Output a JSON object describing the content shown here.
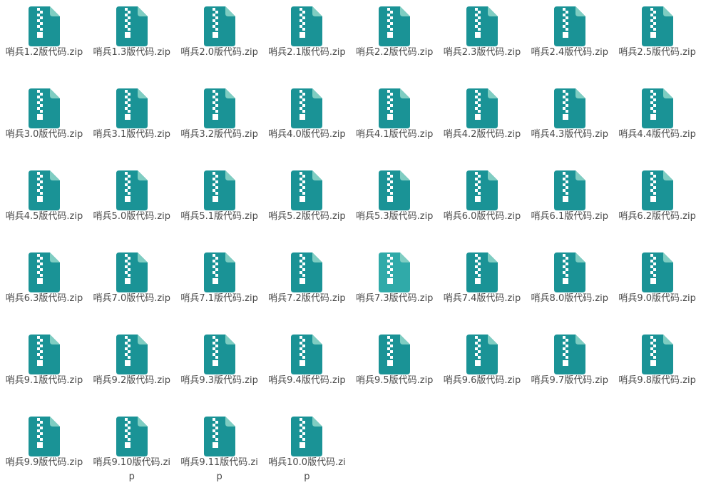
{
  "files": [
    "哨兵1.2版代码.zip",
    "哨兵1.3版代码.zip",
    "哨兵2.0版代码.zip",
    "哨兵2.1版代码.zip",
    "哨兵2.2版代码.zip",
    "哨兵2.3版代码.zip",
    "哨兵2.4版代码.zip",
    "哨兵2.5版代码.zip",
    "哨兵3.0版代码.zip",
    "哨兵3.1版代码.zip",
    "哨兵3.2版代码.zip",
    "哨兵4.0版代码.zip",
    "哨兵4.1版代码.zip",
    "哨兵4.2版代码.zip",
    "哨兵4.3版代码.zip",
    "哨兵4.4版代码.zip",
    "哨兵4.5版代码.zip",
    "哨兵5.0版代码.zip",
    "哨兵5.1版代码.zip",
    "哨兵5.2版代码.zip",
    "哨兵5.3版代码.zip",
    "哨兵6.0版代码.zip",
    "哨兵6.1版代码.zip",
    "哨兵6.2版代码.zip",
    "哨兵6.3版代码.zip",
    "哨兵7.0版代码.zip",
    "哨兵7.1版代码.zip",
    "哨兵7.2版代码.zip",
    "哨兵7.3版代码.zip",
    "哨兵7.4版代码.zip",
    "哨兵8.0版代码.zip",
    "哨兵9.0版代码.zip",
    "哨兵9.1版代码.zip",
    "哨兵9.2版代码.zip",
    "哨兵9.3版代码.zip",
    "哨兵9.4版代码.zip",
    "哨兵9.5版代码.zip",
    "哨兵9.6版代码.zip",
    "哨兵9.7版代码.zip",
    "哨兵9.8版代码.zip",
    "哨兵9.9版代码.zip",
    "哨兵9.10版代码.zip",
    "哨兵9.11版代码.zip",
    "哨兵10.0版代码.zip"
  ],
  "icon": "zip-archive-icon",
  "colors": {
    "icon_body": "#1a9396",
    "icon_body_hover": "#30aaa9",
    "icon_fold": "#7fcdc2",
    "zipper": "#ffffff",
    "label_text": "#4a4a4a",
    "background": "#ffffff"
  },
  "hovered_file": "哨兵7.3版代码.zip"
}
